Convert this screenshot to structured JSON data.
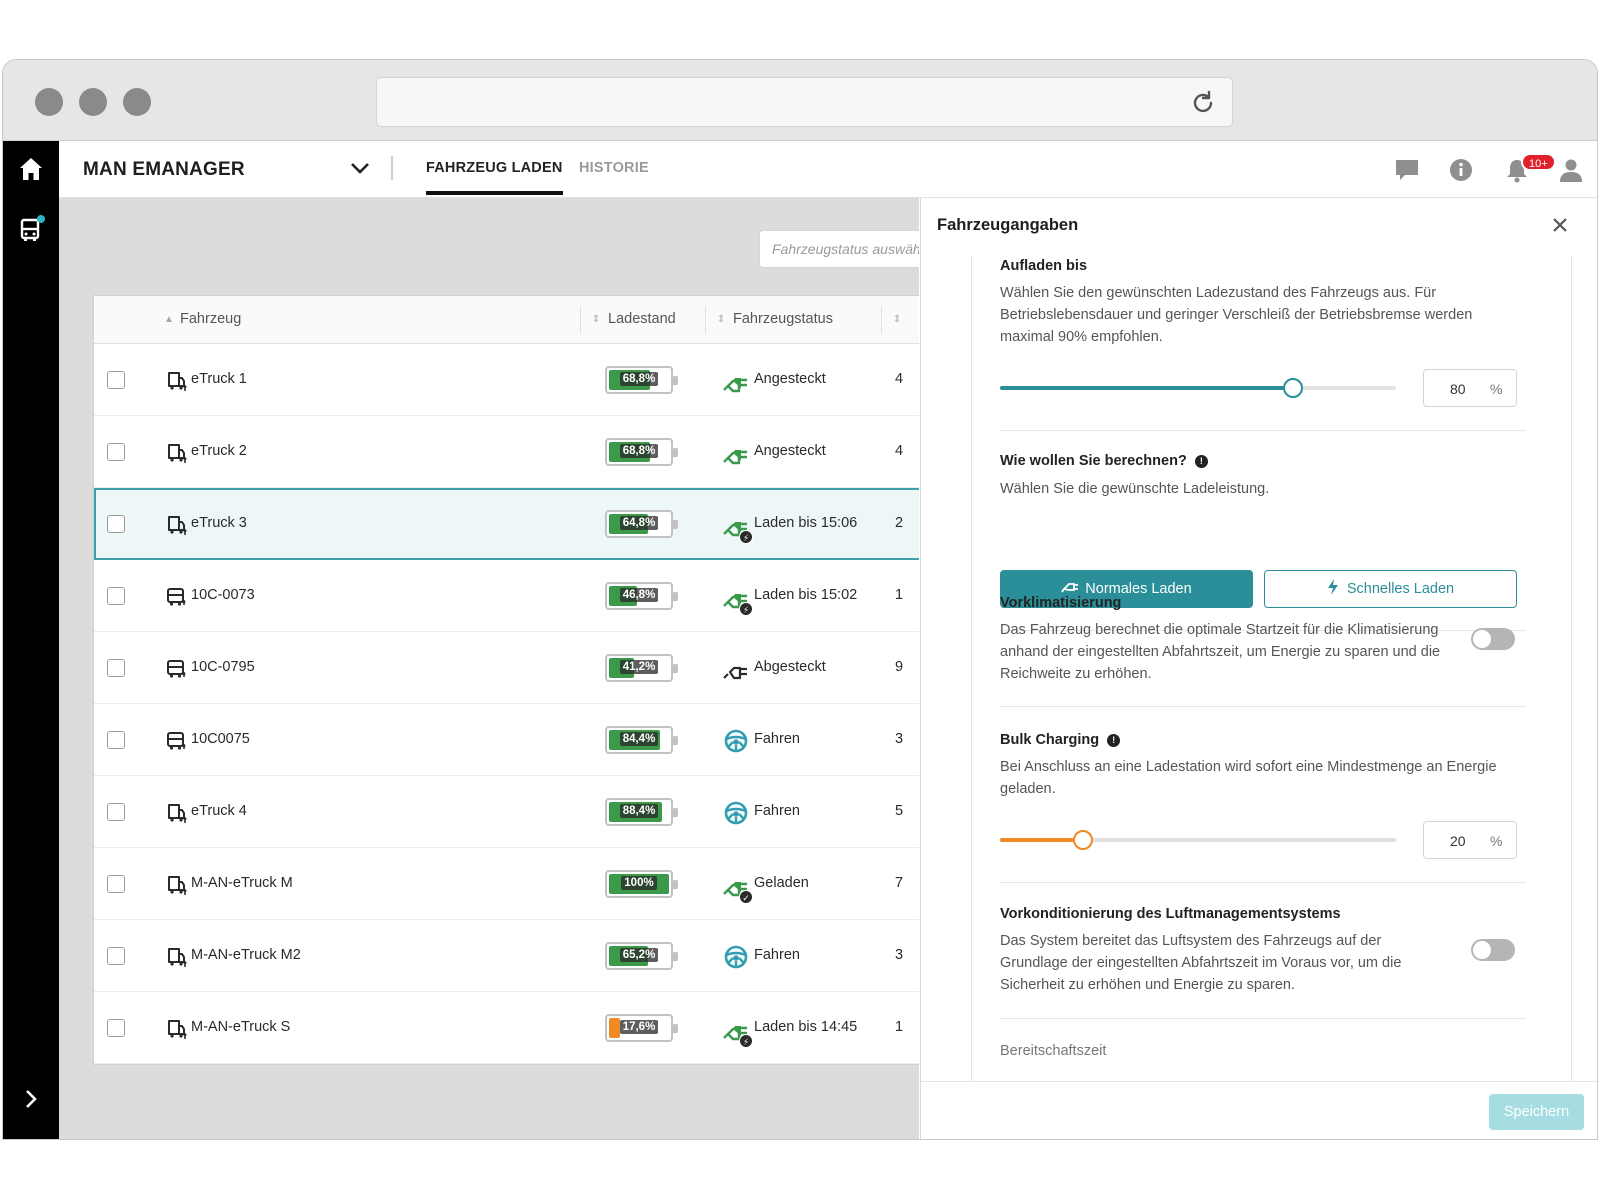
{
  "app": {
    "brand": "MAN EMANAGER",
    "tabs": [
      {
        "label": "FAHRZEUG LADEN",
        "active": true
      },
      {
        "label": "HISTORIE",
        "active": false
      }
    ],
    "notification_badge": "10+"
  },
  "filter": {
    "placeholder": "Fahrzeugstatus auswählen"
  },
  "table": {
    "headers": {
      "vehicle": "Fahrzeug",
      "charge": "Ladestand",
      "status": "Fahrzeugstatus"
    },
    "rows": [
      {
        "name": "eTruck 1",
        "vehicle_type": "truck",
        "charge_pct": 68.8,
        "charge_label": "68,8%",
        "status": "Angesteckt",
        "status_kind": "plugged",
        "extra": "4"
      },
      {
        "name": "eTruck 2",
        "vehicle_type": "truck",
        "charge_pct": 68.8,
        "charge_label": "68,8%",
        "status": "Angesteckt",
        "status_kind": "plugged",
        "extra": "4"
      },
      {
        "name": "eTruck 3",
        "vehicle_type": "truck",
        "charge_pct": 64.8,
        "charge_label": "64,8%",
        "status": "Laden bis 15:06",
        "status_kind": "charging",
        "extra": "2",
        "selected": true
      },
      {
        "name": "10C-0073",
        "vehicle_type": "bus",
        "charge_pct": 46.8,
        "charge_label": "46,8%",
        "status": "Laden bis 15:02",
        "status_kind": "charging",
        "extra": "1"
      },
      {
        "name": "10C-0795",
        "vehicle_type": "bus",
        "charge_pct": 41.2,
        "charge_label": "41,2%",
        "status": "Abgesteckt",
        "status_kind": "unplugged",
        "extra": "9"
      },
      {
        "name": "10C0075",
        "vehicle_type": "bus",
        "charge_pct": 84.4,
        "charge_label": "84,4%",
        "status": "Fahren",
        "status_kind": "driving",
        "extra": "3"
      },
      {
        "name": "eTruck 4",
        "vehicle_type": "truck",
        "charge_pct": 88.4,
        "charge_label": "88,4%",
        "status": "Fahren",
        "status_kind": "driving",
        "extra": "5"
      },
      {
        "name": "M-AN-eTruck M",
        "vehicle_type": "truck",
        "charge_pct": 100,
        "charge_label": "100%",
        "status": "Geladen",
        "status_kind": "charged",
        "extra": "7"
      },
      {
        "name": "M-AN-eTruck M2",
        "vehicle_type": "truck",
        "charge_pct": 65.2,
        "charge_label": "65,2%",
        "status": "Fahren",
        "status_kind": "driving",
        "extra": "3"
      },
      {
        "name": "M-AN-eTruck S",
        "vehicle_type": "truck",
        "charge_pct": 17.6,
        "charge_label": "17,6%",
        "status": "Laden bis 14:45",
        "status_kind": "charging",
        "extra": "1"
      }
    ]
  },
  "panel": {
    "title": "Fahrzeugangaben",
    "charge_to": {
      "heading": "Aufladen bis",
      "text": "Wählen Sie den gewünschten Ladezustand des Fahrzeugs aus. Für Betriebslebensdauer und geringer Verschleiß der Betriebsbremse werden maximal 90% empfohlen.",
      "value": "80",
      "value_num": 80,
      "unit": "%"
    },
    "calc": {
      "heading": "Wie wollen Sie berechnen?",
      "text": "Wählen Sie die gewünschte Ladeleistung.",
      "normal_label": "Normales Laden",
      "fast_label": "Schnelles Laden"
    },
    "preclim": {
      "heading": "Vorklimatisierung",
      "text": "Das Fahrzeug berechnet die optimale Startzeit für die Klimatisierung anhand der eingestellten Abfahrtszeit, um Energie zu sparen und die Reichweite zu erhöhen."
    },
    "bulk": {
      "heading": "Bulk Charging",
      "text": "Bei Anschluss an eine Ladestation wird sofort eine Mindestmenge an Energie geladen.",
      "value": "20",
      "value_num": 20,
      "unit": "%"
    },
    "air": {
      "heading": "Vorkonditionierung des Luftmanagementsystems",
      "text": "Das System bereitet das Luftsystem des Fahrzeugs auf der Grundlage der eingestellten Abfahrtszeit im Voraus vor, um die Sicherheit zu erhöhen und Energie zu sparen."
    },
    "standby": {
      "heading": "Bereitschaftszeit"
    },
    "save_label": "Speichern"
  },
  "colors": {
    "teal": "#2b8f99",
    "battery_green": "#3b9a4a",
    "battery_orange": "#f08a24",
    "slider_orange": "#f08a24",
    "status_green": "#3b9a4a",
    "driving_teal": "#2f9fb0"
  }
}
